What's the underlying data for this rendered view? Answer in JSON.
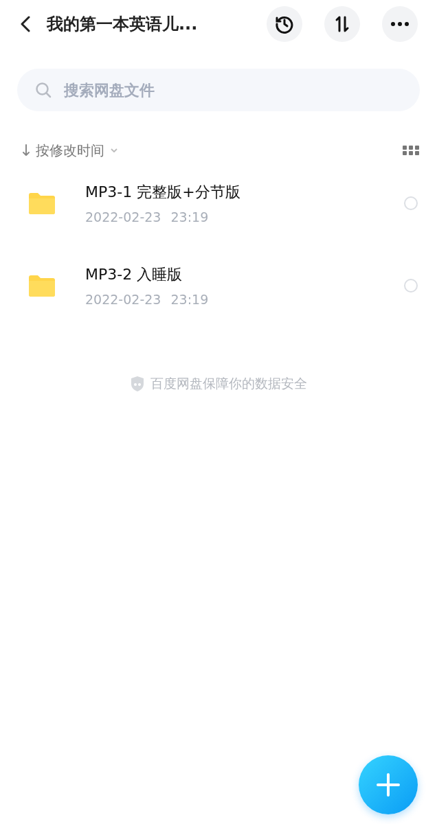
{
  "header": {
    "title": "我的第一本英语儿..."
  },
  "search": {
    "placeholder": "搜索网盘文件"
  },
  "sort": {
    "label": "按修改时间"
  },
  "files": [
    {
      "name": "MP3-1 完整版+分节版",
      "date": "2022-02-23",
      "time": "23:19",
      "selected": false
    },
    {
      "name": "MP3-2 入睡版",
      "date": "2022-02-23",
      "time": "23:19",
      "selected": false
    }
  ],
  "footer_note": "百度网盘保障你的数据安全"
}
